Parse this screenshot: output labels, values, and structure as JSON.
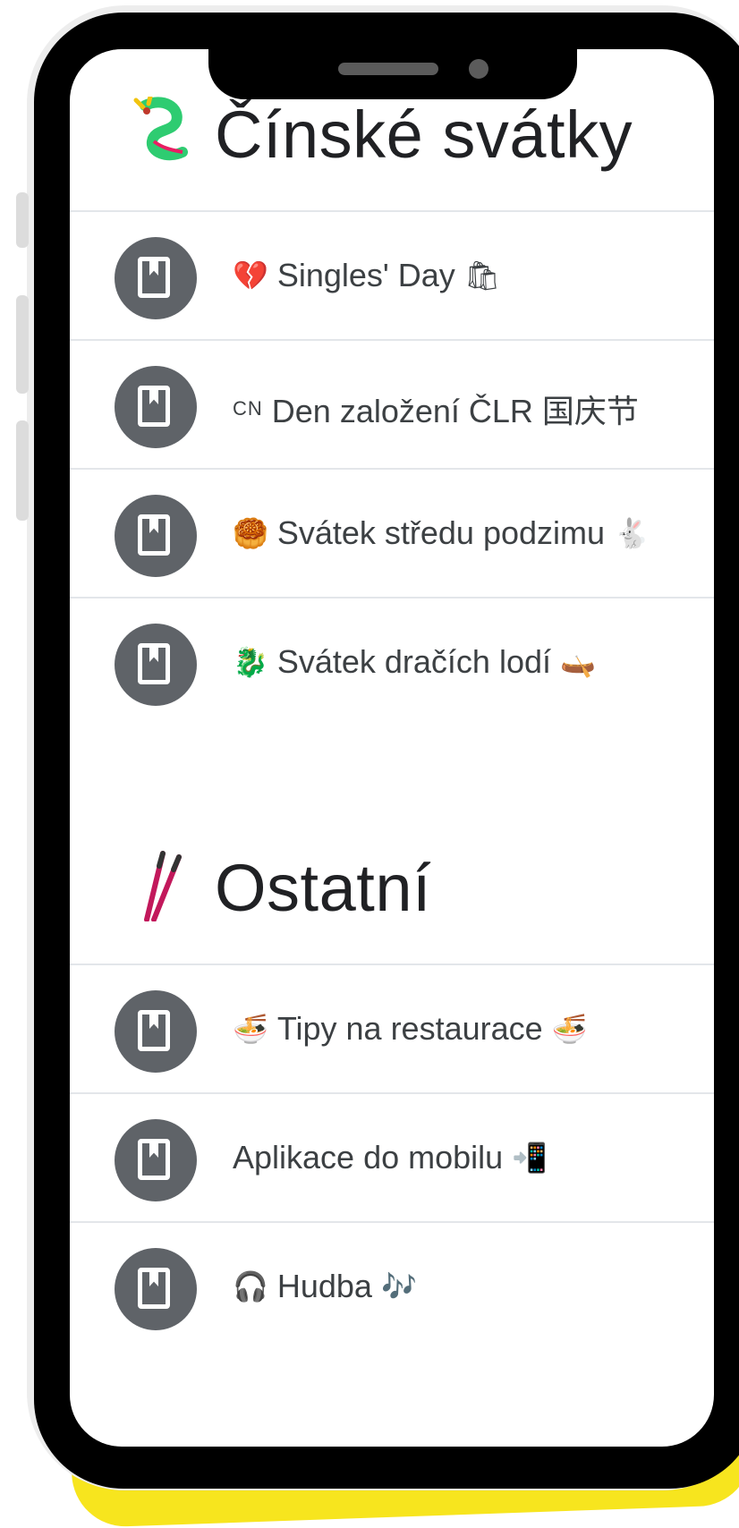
{
  "sections": [
    {
      "title": "Čínské svátky",
      "icon": "dragon-icon",
      "items": [
        {
          "prefix": "💔",
          "label": "Singles' Day",
          "suffix": "🛍"
        },
        {
          "prefix": "CN",
          "label": "Den založení ČLR 国庆节",
          "suffix": ""
        },
        {
          "prefix": "🥮",
          "label": "Svátek středu podzimu",
          "suffix": "🐇"
        },
        {
          "prefix": "🐉",
          "label": "Svátek dračích lodí",
          "suffix": "🛶"
        }
      ]
    },
    {
      "title": "Ostatní",
      "icon": "chopsticks-icon",
      "items": [
        {
          "prefix": "🍜",
          "label": "Tipy na restaurace",
          "suffix": "🍜"
        },
        {
          "prefix": "",
          "label": "Aplikace do mobilu",
          "suffix": "📲"
        },
        {
          "prefix": "🎧",
          "label": "Hudba",
          "suffix": "🎶"
        }
      ]
    }
  ],
  "colors": {
    "icon_circle": "#5f6368",
    "text": "#3c4043",
    "divider": "#e3e6ea",
    "accent": "#f7e51e"
  }
}
